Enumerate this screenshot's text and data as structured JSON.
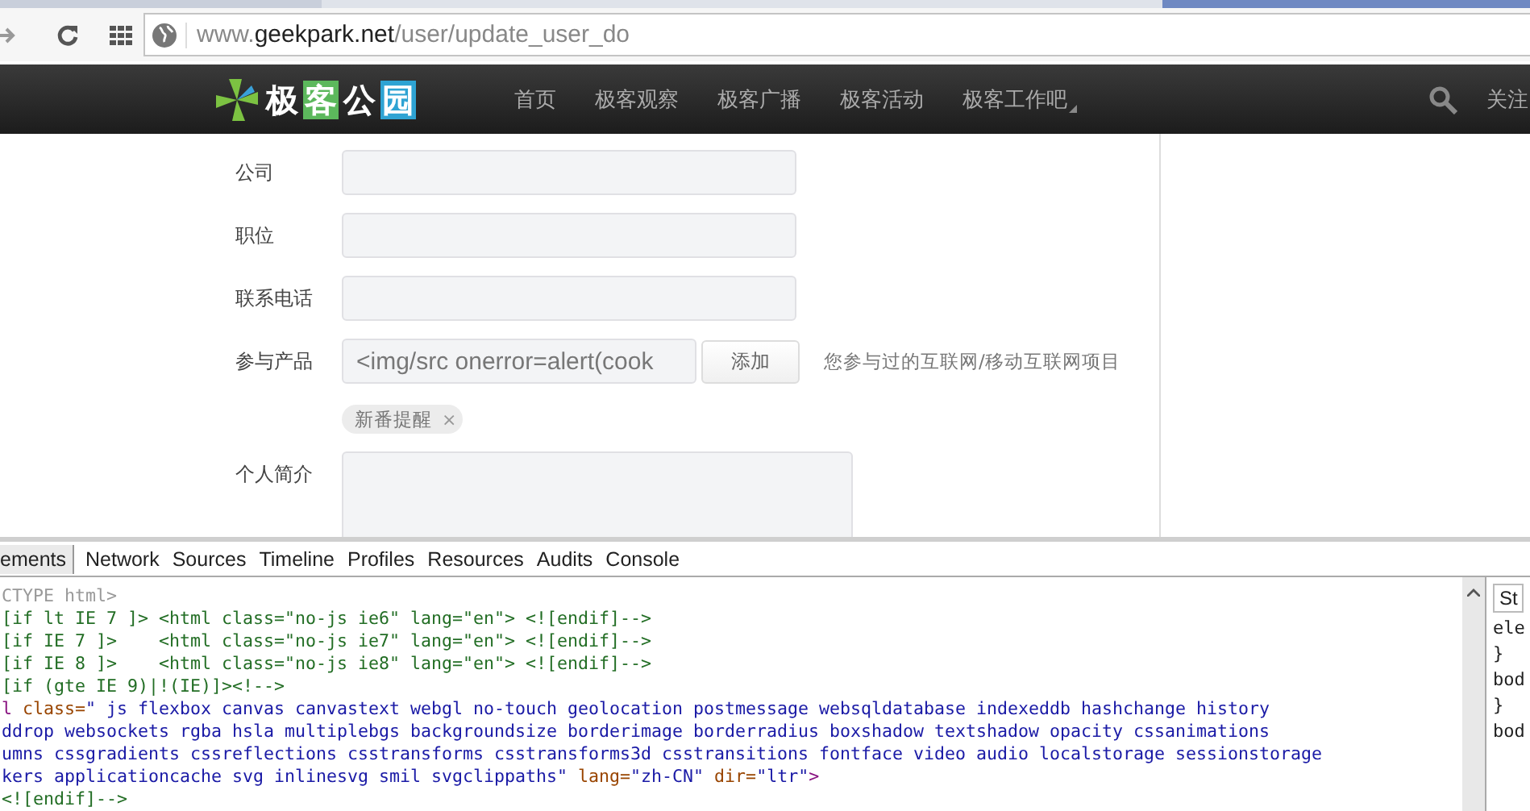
{
  "browser": {
    "url_parts": [
      {
        "text": "www.",
        "kind": "dim"
      },
      {
        "text": "geekpark.net",
        "kind": "host"
      },
      {
        "text": "/user/update_user_do",
        "kind": "dim"
      }
    ]
  },
  "site_nav": {
    "logo": [
      {
        "text": "极",
        "kind": "plain"
      },
      {
        "text": "客",
        "kind": "green"
      },
      {
        "text": "公",
        "kind": "plain"
      },
      {
        "text": "园",
        "kind": "blue"
      }
    ],
    "items": [
      {
        "label": "首页",
        "dropdown": false
      },
      {
        "label": "极客观察",
        "dropdown": false
      },
      {
        "label": "极客广播",
        "dropdown": false
      },
      {
        "label": "极客活动",
        "dropdown": false
      },
      {
        "label": "极客工作吧",
        "dropdown": true
      }
    ],
    "follow": "关注"
  },
  "form": {
    "rows": [
      {
        "kind": "text",
        "label": "公司"
      },
      {
        "kind": "text",
        "label": "职位"
      },
      {
        "kind": "text",
        "label": "联系电话"
      },
      {
        "kind": "product",
        "label": "参与产品",
        "value": "<img/src onerror=alert(cook",
        "button": "添加",
        "hint": "您参与过的互联网/移动互联网项目",
        "tags": [
          {
            "label": "新番提醒",
            "remove": "×"
          }
        ]
      },
      {
        "kind": "textarea",
        "label": "个人简介"
      }
    ]
  },
  "devtools": {
    "tabs": [
      {
        "label": "ements",
        "selected": true
      },
      {
        "label": "Network",
        "selected": false
      },
      {
        "label": "Sources",
        "selected": false
      },
      {
        "label": "Timeline",
        "selected": false
      },
      {
        "label": "Profiles",
        "selected": false
      },
      {
        "label": "Resources",
        "selected": false
      },
      {
        "label": "Audits",
        "selected": false
      },
      {
        "label": "Console",
        "selected": false
      }
    ],
    "lines": [
      [
        {
          "text": "CTYPE html>",
          "kind": "doctype"
        }
      ],
      [
        {
          "text": "[if lt IE 7 ]> <html class=\"no-js ie6\" lang=\"en\"> <![endif]-->",
          "kind": "comment"
        }
      ],
      [
        {
          "text": "[if IE 7 ]>    <html class=\"no-js ie7\" lang=\"en\"> <![endif]-->",
          "kind": "comment"
        }
      ],
      [
        {
          "text": "[if IE 8 ]>    <html class=\"no-js ie8\" lang=\"en\"> <![endif]-->",
          "kind": "comment"
        }
      ],
      [
        {
          "text": "[if (gte IE 9)|!(IE)]><!-->",
          "kind": "comment"
        }
      ],
      [
        {
          "text": "l",
          "kind": "tag"
        },
        {
          "text": " class=",
          "kind": "attr"
        },
        {
          "text": "\" js flexbox canvas canvastext webgl no-touch geolocation postmessage websqldatabase indexeddb hashchange history",
          "kind": "value"
        }
      ],
      [
        {
          "text": "ddrop websockets rgba hsla multiplebgs backgroundsize borderimage borderradius boxshadow textshadow opacity cssanimations",
          "kind": "value"
        }
      ],
      [
        {
          "text": "umns cssgradients cssreflections csstransforms csstransforms3d csstransitions fontface video audio localstorage sessionstorage",
          "kind": "value"
        }
      ],
      [
        {
          "text": "kers applicationcache svg inlinesvg smil svgclippaths\"",
          "kind": "value"
        },
        {
          "text": " lang=",
          "kind": "attr"
        },
        {
          "text": "\"zh-CN\"",
          "kind": "value"
        },
        {
          "text": " dir=",
          "kind": "attr"
        },
        {
          "text": "\"ltr\"",
          "kind": "value"
        },
        {
          "text": ">",
          "kind": "tag"
        }
      ],
      [
        {
          "text": "<![endif]-->",
          "kind": "comment"
        }
      ]
    ],
    "styles_tab": "St",
    "styles_lines": [
      "ele",
      "}",
      "bod",
      "}",
      "bod"
    ]
  }
}
